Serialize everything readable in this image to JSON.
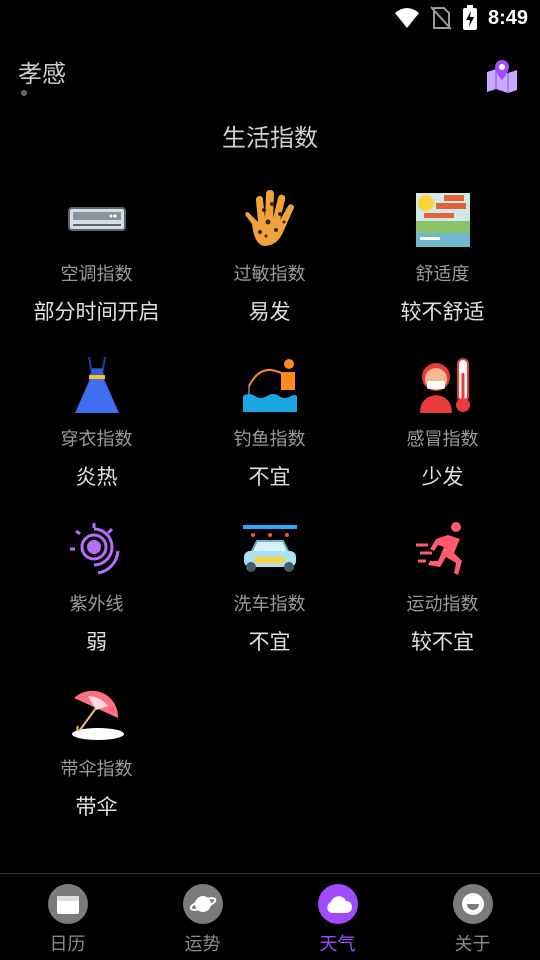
{
  "status": {
    "time": "8:49"
  },
  "header": {
    "city": "孝感"
  },
  "section": {
    "title": "生活指数"
  },
  "indices": [
    {
      "icon": "air-conditioner-icon",
      "label": "空调指数",
      "value": "部分时间开启"
    },
    {
      "icon": "allergy-hand-icon",
      "label": "过敏指数",
      "value": "易发"
    },
    {
      "icon": "comfort-scene-icon",
      "label": "舒适度",
      "value": "较不舒适"
    },
    {
      "icon": "dress-icon",
      "label": "穿衣指数",
      "value": "炎热"
    },
    {
      "icon": "fishing-icon",
      "label": "钓鱼指数",
      "value": "不宜"
    },
    {
      "icon": "cold-thermometer-icon",
      "label": "感冒指数",
      "value": "少发"
    },
    {
      "icon": "uv-icon",
      "label": "紫外线",
      "value": "弱"
    },
    {
      "icon": "car-wash-icon",
      "label": "洗车指数",
      "value": "不宜"
    },
    {
      "icon": "running-icon",
      "label": "运动指数",
      "value": "较不宜"
    },
    {
      "icon": "umbrella-icon",
      "label": "带伞指数",
      "value": "带伞"
    }
  ],
  "nav": {
    "tabs": [
      {
        "label": "日历",
        "icon": "calendar-icon"
      },
      {
        "label": "运势",
        "icon": "planet-icon"
      },
      {
        "label": "天气",
        "icon": "cloud-icon",
        "active": true
      },
      {
        "label": "关于",
        "icon": "about-icon"
      }
    ]
  },
  "colors": {
    "accent": "#a14bff",
    "background": "#000000"
  }
}
